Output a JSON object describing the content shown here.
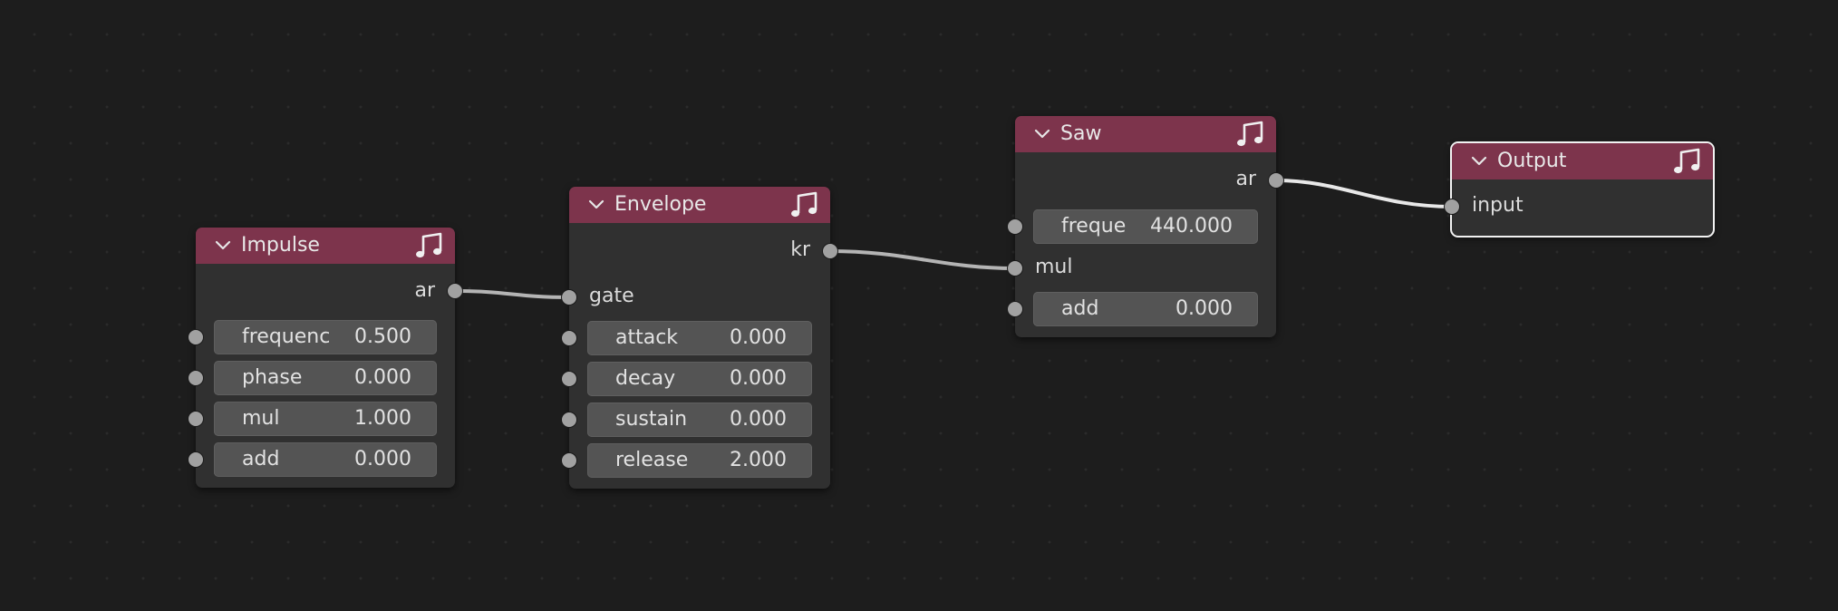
{
  "colors": {
    "background": "#1d1d1d",
    "node_body": "#303030",
    "node_header": "#7d344c",
    "field": "#545454",
    "socket": "#a1a1a1",
    "link": "#b8b8b8",
    "selected_outline": "#f2f2f2"
  },
  "nodes": {
    "impulse": {
      "title": "Impulse",
      "icon": "music-note-icon",
      "output": "ar",
      "fields": [
        {
          "name": "frequenc",
          "value": "0.500"
        },
        {
          "name": "phase",
          "value": "0.000"
        },
        {
          "name": "mul",
          "value": "1.000"
        },
        {
          "name": "add",
          "value": "0.000"
        }
      ]
    },
    "envelope": {
      "title": "Envelope",
      "icon": "music-note-icon",
      "output": "kr",
      "input": "gate",
      "fields": [
        {
          "name": "attack",
          "value": "0.000"
        },
        {
          "name": "decay",
          "value": "0.000"
        },
        {
          "name": "sustain",
          "value": "0.000"
        },
        {
          "name": "release",
          "value": "2.000"
        }
      ]
    },
    "saw": {
      "title": "Saw",
      "icon": "music-note-icon",
      "output": "ar",
      "input": "mul",
      "fields": [
        {
          "name": "freque",
          "value": "440.000"
        },
        {
          "name": "add",
          "value": "0.000"
        }
      ]
    },
    "output": {
      "title": "Output",
      "icon": "music-note-icon",
      "input": "input",
      "selected": true
    }
  }
}
